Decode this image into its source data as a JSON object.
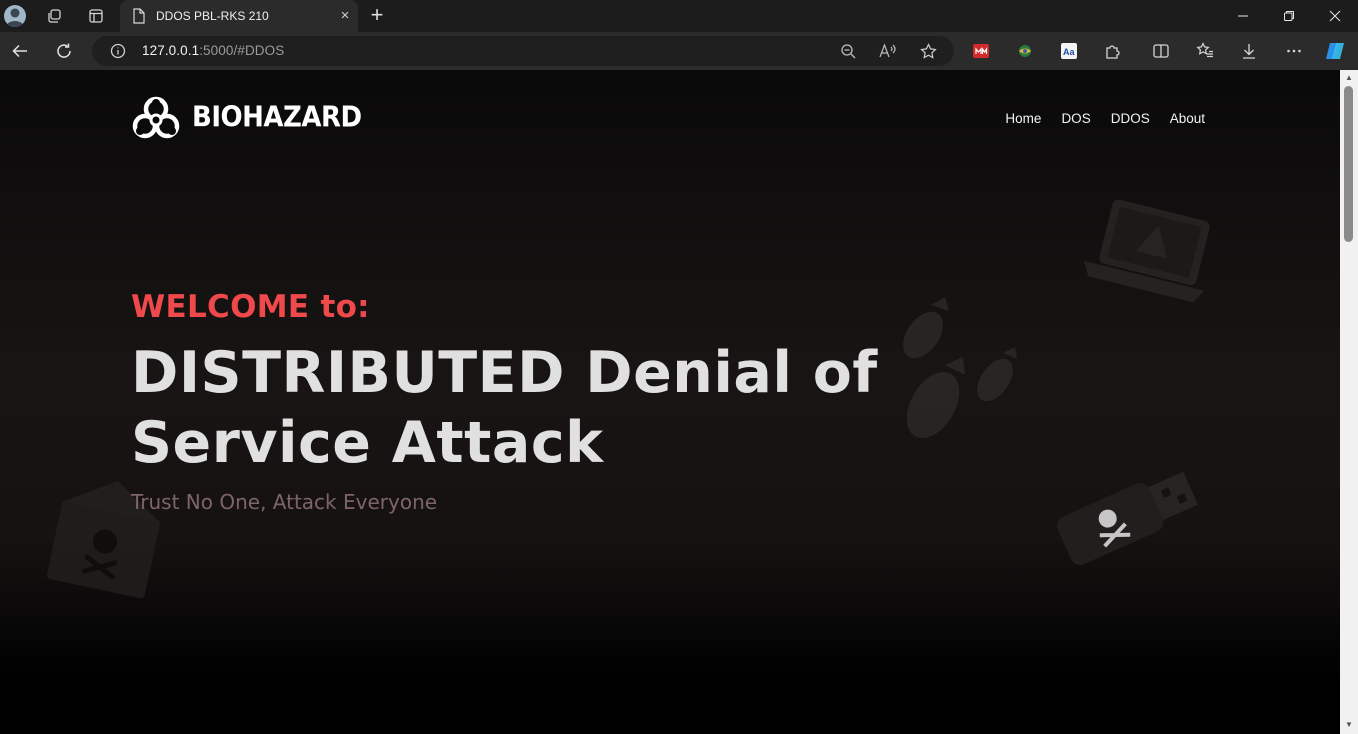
{
  "browser": {
    "tab_title": "DDOS PBL-RKS 210",
    "url_host": "127.0.0.1",
    "url_path": ":5000/#DDOS",
    "new_tab_symbol": "+",
    "close_symbol": "×"
  },
  "site": {
    "brand": "BIOHAZARD",
    "nav": [
      {
        "label": "Home"
      },
      {
        "label": "DOS"
      },
      {
        "label": "DDOS"
      },
      {
        "label": "About"
      }
    ]
  },
  "hero": {
    "welcome": "WELCOME to:",
    "headline_line1": "DISTRIBUTED Denial of",
    "headline_line2": "Service Attack",
    "tagline": "Trust No One, Attack Everyone"
  },
  "colors": {
    "accent": "#f0494b",
    "headline": "#e0e0e0",
    "tagline": "#7e6565",
    "background": "#151111"
  },
  "icons": [
    "biohazard-icon",
    "laptop-warning-icon",
    "bomb-icon",
    "envelope-skull-icon",
    "usb-skull-icon"
  ]
}
